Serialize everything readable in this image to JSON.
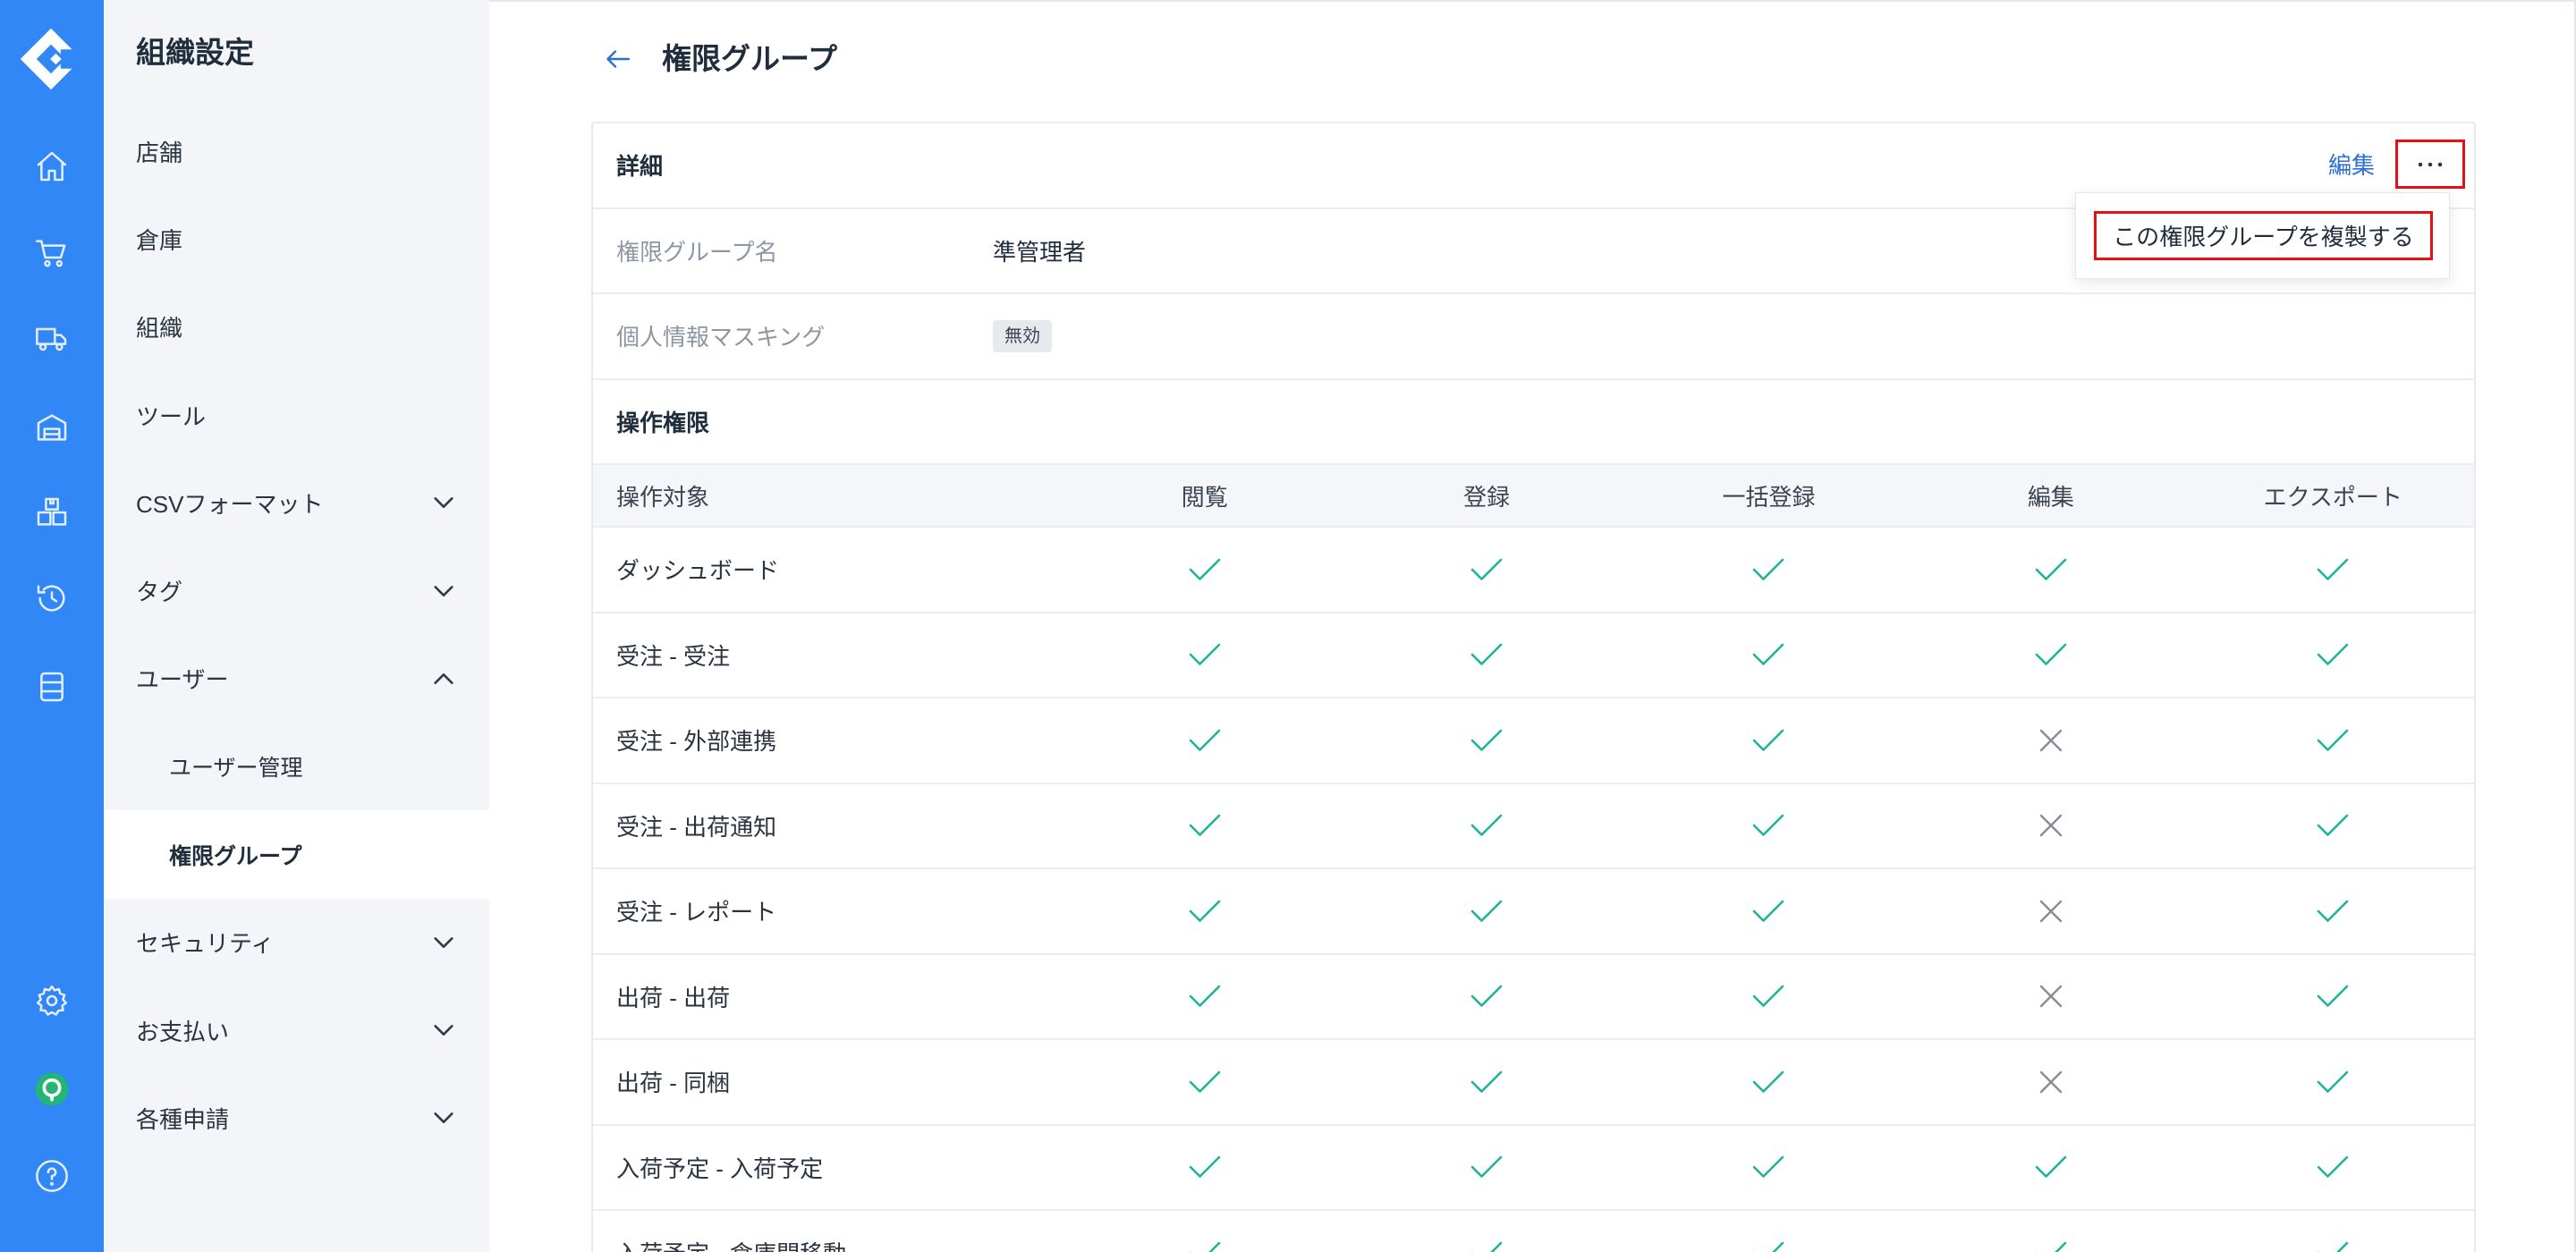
{
  "colors": {
    "rail": "#3087f5",
    "link": "#2d6fd8",
    "check": "#1fb39b",
    "cross": "#868d97",
    "highlight": "#e60f14",
    "support": "#22b573"
  },
  "rail": {
    "logo": "logo-icon",
    "nav_icons": [
      "home-icon",
      "cart-icon",
      "truck-icon",
      "warehouse-icon",
      "boxes-icon",
      "history-icon",
      "list-icon"
    ],
    "bottom_icons": [
      "gear-icon",
      "support-icon",
      "help-icon"
    ]
  },
  "sidebar": {
    "title": "組織設定",
    "items": [
      {
        "label": "店舗"
      },
      {
        "label": "倉庫"
      },
      {
        "label": "組織"
      },
      {
        "label": "ツール"
      },
      {
        "label": "CSVフォーマット",
        "icon": "chevron-down-icon"
      },
      {
        "label": "タグ",
        "icon": "chevron-down-icon"
      },
      {
        "label": "ユーザー",
        "icon": "chevron-up-icon",
        "expanded": true,
        "children": [
          {
            "label": "ユーザー管理"
          },
          {
            "label": "権限グループ",
            "active": true
          }
        ]
      },
      {
        "label": "セキュリティ",
        "icon": "chevron-down-icon"
      },
      {
        "label": "お支払い",
        "icon": "chevron-down-icon"
      },
      {
        "label": "各種申請",
        "icon": "chevron-down-icon"
      }
    ]
  },
  "header": {
    "back_icon": "arrow-left-icon",
    "title": "権限グループ"
  },
  "detail": {
    "heading": "詳細",
    "edit_label": "編集",
    "more_icon": "more-horizontal-icon",
    "more_menu": {
      "items": [
        "この権限グループを複製する"
      ]
    },
    "fields": [
      {
        "label": "権限グループ名",
        "value": "準管理者"
      },
      {
        "label": "個人情報マスキング",
        "badge": "無効"
      }
    ]
  },
  "permissions": {
    "heading": "操作権限",
    "columns": [
      "操作対象",
      "閲覧",
      "登録",
      "一括登録",
      "編集",
      "エクスポート"
    ],
    "rows": [
      {
        "target": "ダッシュボード",
        "values": [
          true,
          true,
          true,
          true,
          true
        ]
      },
      {
        "target": "受注 - 受注",
        "values": [
          true,
          true,
          true,
          true,
          true
        ]
      },
      {
        "target": "受注 - 外部連携",
        "values": [
          true,
          true,
          true,
          false,
          true
        ]
      },
      {
        "target": "受注 - 出荷通知",
        "values": [
          true,
          true,
          true,
          false,
          true
        ]
      },
      {
        "target": "受注 - レポート",
        "values": [
          true,
          true,
          true,
          false,
          true
        ]
      },
      {
        "target": "出荷 - 出荷",
        "values": [
          true,
          true,
          true,
          false,
          true
        ]
      },
      {
        "target": "出荷 - 同梱",
        "values": [
          true,
          true,
          true,
          false,
          true
        ]
      },
      {
        "target": "入荷予定 - 入荷予定",
        "values": [
          true,
          true,
          true,
          true,
          true
        ]
      },
      {
        "target": "入荷予定 - 倉庫間移動",
        "values": [
          true,
          true,
          true,
          true,
          true
        ]
      }
    ]
  }
}
